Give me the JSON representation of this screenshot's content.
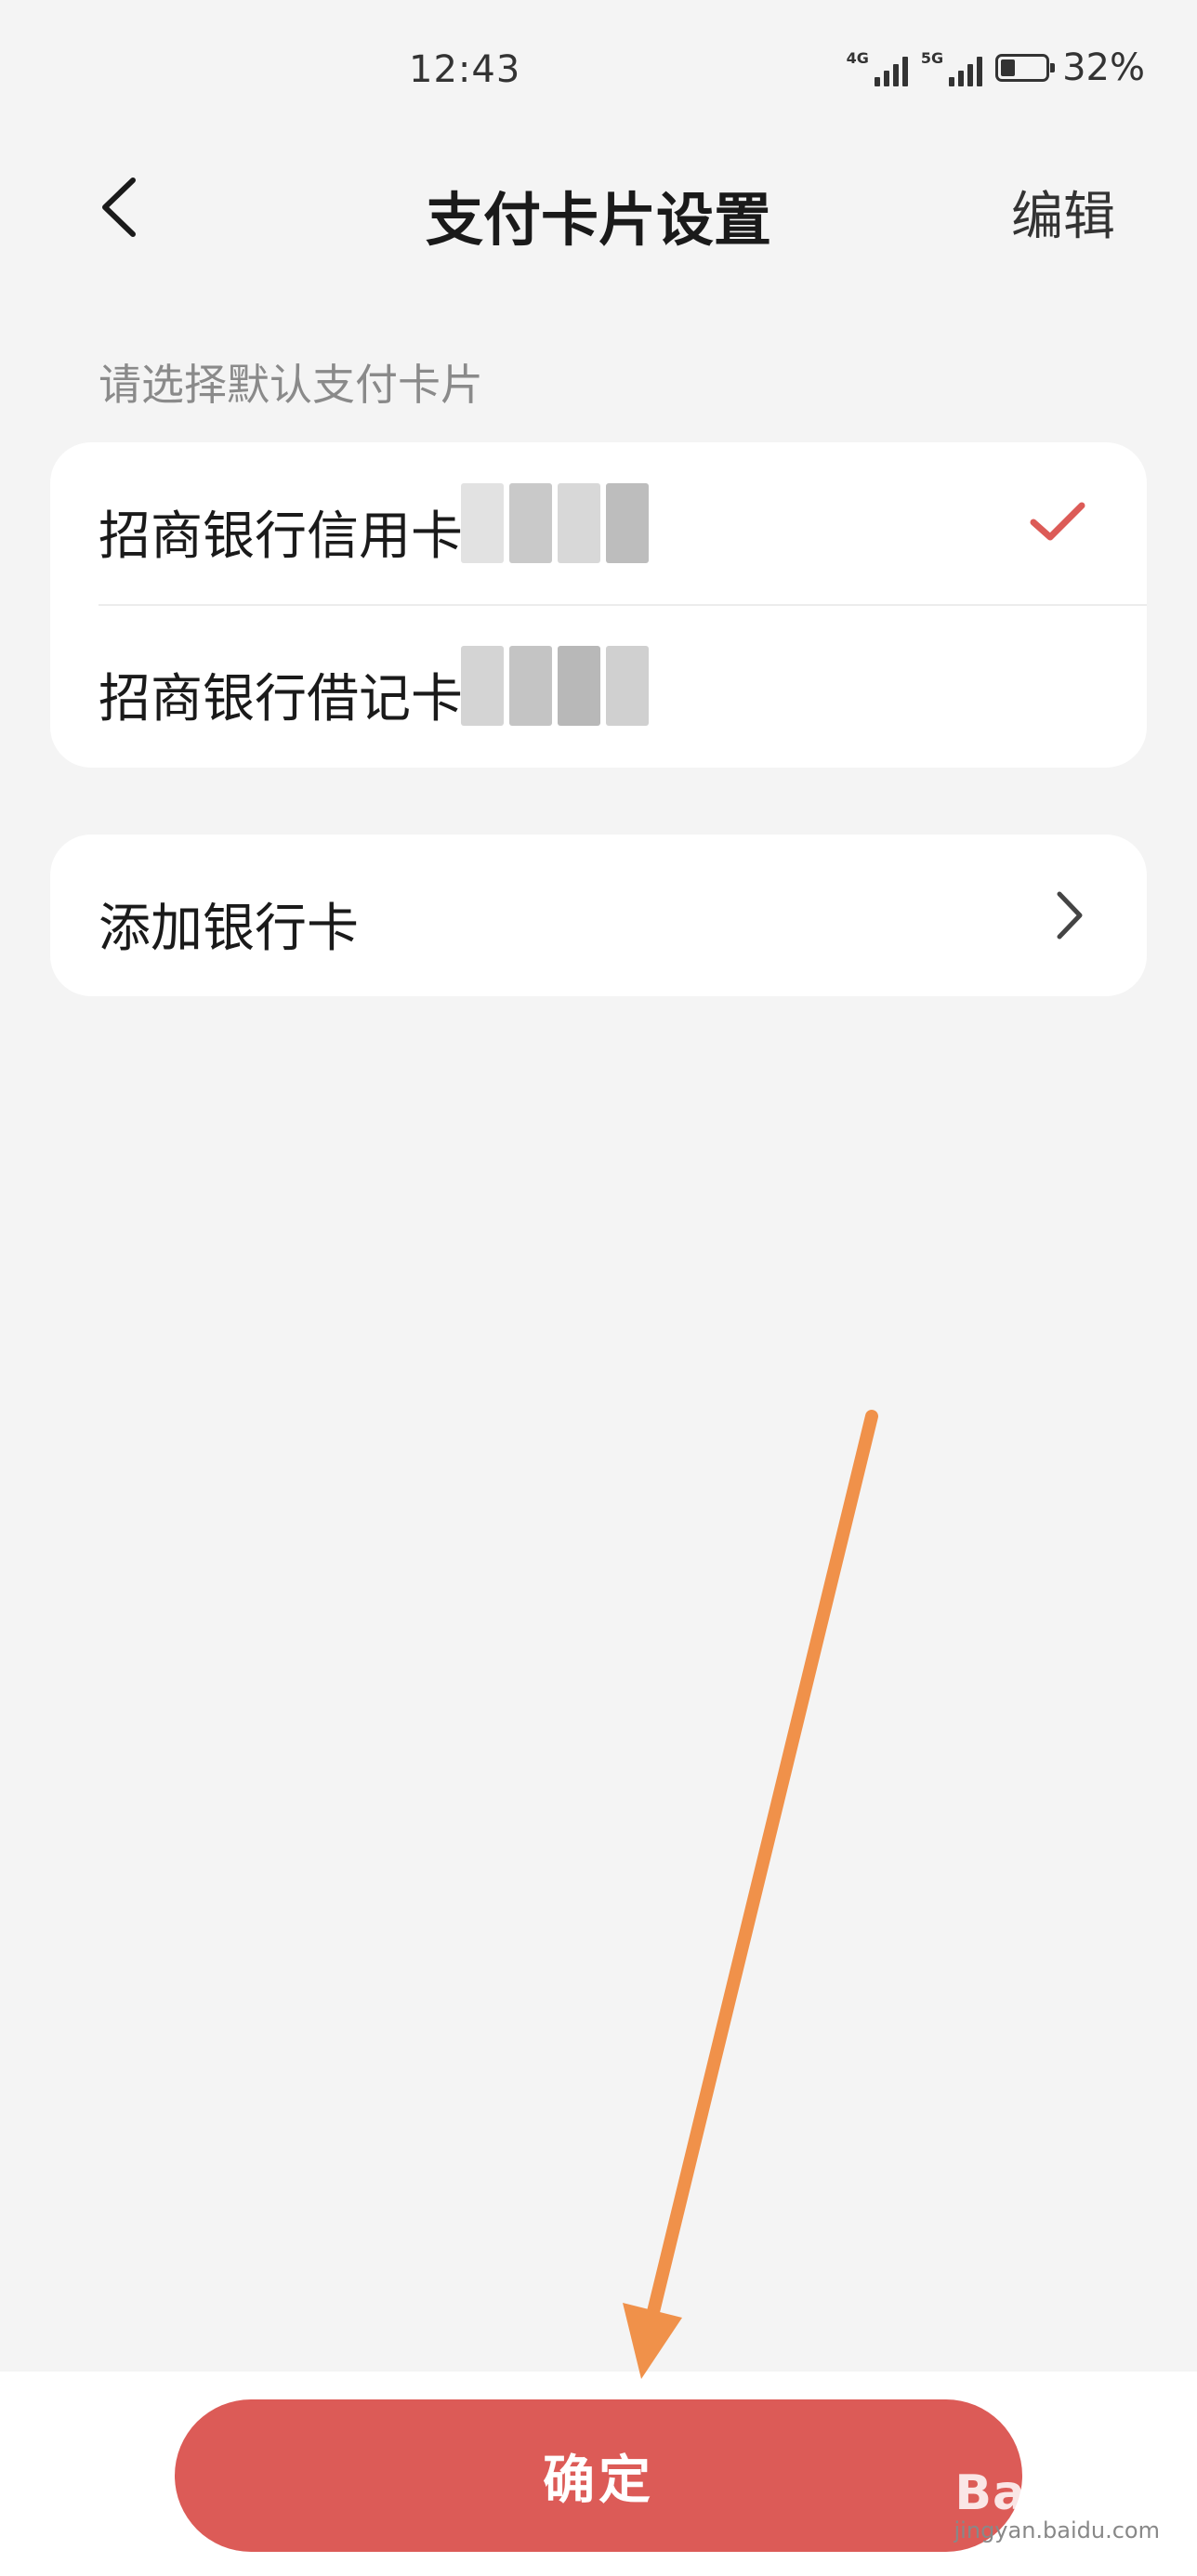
{
  "status_bar": {
    "time": "12:43",
    "network1": "4G",
    "network2": "5G",
    "battery_percent": "32%",
    "battery_level": 0.32
  },
  "header": {
    "back_icon": "chevron-left-icon",
    "title": "支付卡片设置",
    "edit_label": "编辑"
  },
  "section_label": "请选择默认支付卡片",
  "cards": [
    {
      "label": "招商银行信用卡",
      "selected": true
    },
    {
      "label": "招商银行借记卡",
      "selected": false
    }
  ],
  "add_card": {
    "label": "添加银行卡",
    "icon": "chevron-right-icon"
  },
  "confirm_button": {
    "label": "确定",
    "color": "#dc5b57"
  },
  "accent_color": "#dc5b57",
  "annotation_arrow_color": "#f0914a",
  "watermark": {
    "logo": "Bai 经验",
    "sub": "jingyan.baidu.com"
  }
}
